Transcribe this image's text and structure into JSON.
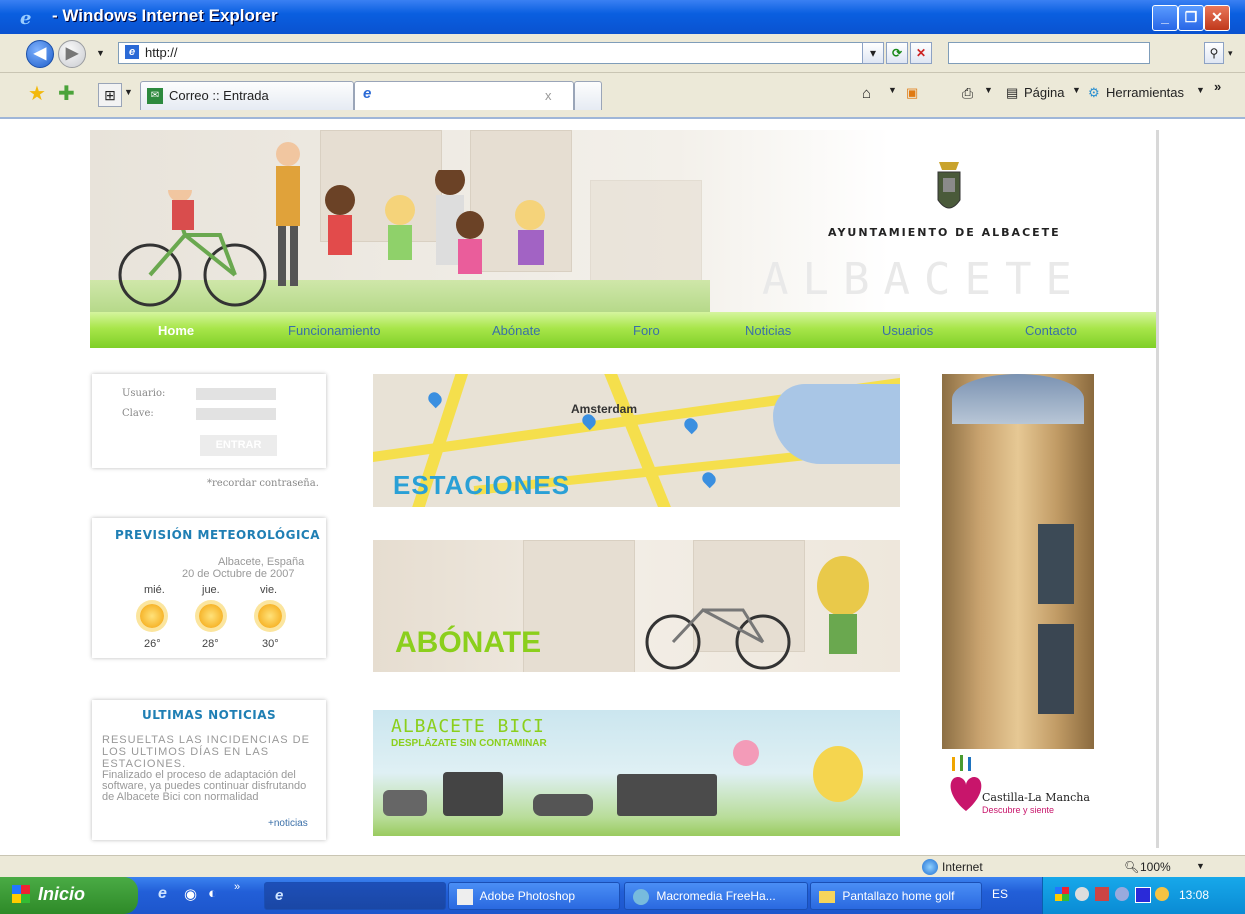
{
  "window": {
    "title": "- Windows Internet Explorer",
    "min": "_",
    "max": "❐",
    "close": "✕"
  },
  "address": {
    "url": "http://"
  },
  "tabs": {
    "fav_tab": "Correo :: Entrada",
    "active_tab_close": "x"
  },
  "command_bar": {
    "page": "Página",
    "tools": "Herramientas"
  },
  "site": {
    "brand": "AYUNTAMIENTO DE ALBACETE",
    "big_title": "ALBACETE BICI",
    "nav": [
      "Home",
      "Funcionamiento",
      "Abónate",
      "Foro",
      "Noticias",
      "Usuarios",
      "Contacto"
    ]
  },
  "login": {
    "user_label": "Usuario:",
    "pass_label": "Clave:",
    "enter": "ENTRAR",
    "forgot": "*recordar contraseña."
  },
  "weather": {
    "title": "PREVISIÓN METEOROLÓGICA",
    "location": "Albacete, España",
    "date": "20 de Octubre de 2007",
    "days": [
      {
        "day": "mié.",
        "temp": "26°"
      },
      {
        "day": "jue.",
        "temp": "28°"
      },
      {
        "day": "vie.",
        "temp": "30°"
      }
    ]
  },
  "news": {
    "title": "ULTIMAS NOTICIAS",
    "headline": "RESUELTAS LAS INCIDENCIAS DE LOS ULTIMOS DÍAS EN LAS ESTACIONES.",
    "body": "Finalizado el proceso de adaptación del software, ya puedes continuar disfrutando de Albacete Bici con normalidad",
    "more": "+noticias"
  },
  "panels": {
    "map_city": "Amsterdam",
    "estaciones": "ESTACIONES",
    "abonate": "ABÓNATE",
    "eco_title": "ALBACETE BICI",
    "eco_sub": "DESPLÁZATE SIN CONTAMINAR",
    "clm_name": "Castilla-La Mancha",
    "clm_slogan": "Descubre y siente"
  },
  "statusbar": {
    "zone": "Internet",
    "zoom": "100%"
  },
  "taskbar": {
    "start": "Inicio",
    "tasks": [
      "Adobe Photoshop",
      "Macromedia FreeHa...",
      "Pantallazo home golf"
    ],
    "lang": "ES",
    "clock": "13:08"
  }
}
